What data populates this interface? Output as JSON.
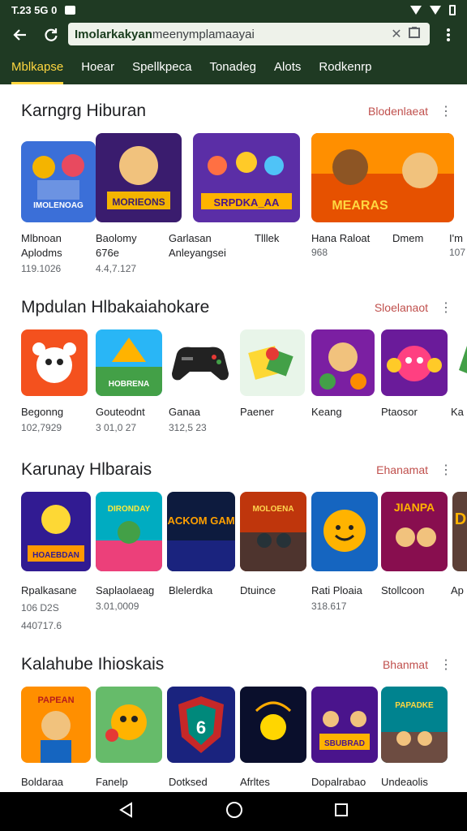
{
  "status_bar": {
    "time": "T.23 5G 0"
  },
  "browser": {
    "back_icon": "arrow-left-icon",
    "refresh_icon": "refresh-icon",
    "url_bold": "Imolarkakyan",
    "url_rest": "meenymplamaayai",
    "clear_icon": "close-icon",
    "tabs_icon": "square-icon",
    "menu_icon": "kebab-icon"
  },
  "tabs": [
    "Mblkapse",
    "Hoear",
    "Spellkpeca",
    "Tonadeg",
    "Alots",
    "Rodkenrp"
  ],
  "sections": [
    {
      "title": "Karngrg Hiburan",
      "more": "Blodenlaeat",
      "apps": [
        {
          "name": "Mlbnoan",
          "line2": "Aplodms",
          "line3": "119.1026",
          "tile_text": "IMOLENOAG"
        },
        {
          "name": "Baolomy",
          "line2": "676e",
          "line3": "4.4,7.127",
          "tile_text": "MORIEONS"
        },
        {
          "name": "Garlasan",
          "line2": "Anleyangsei",
          "line3": "",
          "tile_text": "SRPDKA_AA"
        },
        {
          "name": "Tlllek",
          "line2": "",
          "line3": "",
          "tile_text": ""
        },
        {
          "name": "Hana Raloat",
          "line2": "968",
          "line3": "",
          "tile_text": "MEARAS"
        },
        {
          "name": "Dmem",
          "line2": "",
          "line3": "",
          "tile_text": ""
        },
        {
          "name": "I'm",
          "line2": "107",
          "line3": "",
          "tile_text": ""
        }
      ]
    },
    {
      "title": "Mpdulan Hlbakaiahokare",
      "more": "Sloelanaot",
      "apps": [
        {
          "name": "Begonng",
          "line2": "102,7929",
          "tile_text": ""
        },
        {
          "name": "Gouteodnt",
          "line2": "3 01,0 27",
          "tile_text": "HOBRENA"
        },
        {
          "name": "Ganaa",
          "line2": "312,5 23",
          "tile_text": ""
        },
        {
          "name": "Paener",
          "line2": "",
          "tile_text": ""
        },
        {
          "name": "Keang",
          "line2": "",
          "tile_text": ""
        },
        {
          "name": "Ptaosor",
          "line2": "",
          "tile_text": ""
        },
        {
          "name": "Ka",
          "line2": "",
          "tile_text": ""
        }
      ]
    },
    {
      "title": "Karunay Hlbarais",
      "more": "Ehanamat",
      "apps": [
        {
          "name": "Rpalkasane",
          "line2": "106 D2S",
          "line3": "440717.6",
          "tile_text": "HOAEBDAN"
        },
        {
          "name": "Saplaolaeag",
          "line2": "3.01,0009",
          "line3": "",
          "tile_text": "DIRONDAY"
        },
        {
          "name": "Blelerdka",
          "line2": "",
          "line3": "",
          "tile_text": "SACKOM GAME"
        },
        {
          "name": "Dtuince",
          "line2": "",
          "line3": "",
          "tile_text": "MOLOENA"
        },
        {
          "name": "Rati Ploaia",
          "line2": "318.617",
          "line3": "",
          "tile_text": ""
        },
        {
          "name": "Stollcoon",
          "line2": "",
          "line3": "",
          "tile_text": "JIANPA"
        },
        {
          "name": "Ap",
          "line2": "",
          "line3": "",
          "tile_text": "D"
        }
      ]
    },
    {
      "title": "Kalahube Ihioskais",
      "more": "Bhanmat",
      "apps": [
        {
          "name": "Boldaraa",
          "tile_text": "PAPEAN"
        },
        {
          "name": "Fanelp",
          "tile_text": ""
        },
        {
          "name": "Dotksed",
          "tile_text": "6"
        },
        {
          "name": "Afrltes",
          "tile_text": ""
        },
        {
          "name": "Dopalrabao",
          "tile_text": "SBUBRAD"
        },
        {
          "name": "Undeaolis",
          "tile_text": "PAPADKE"
        }
      ]
    }
  ],
  "nav": {
    "back": "triangle-back-icon",
    "home": "circle-home-icon",
    "recents": "square-recents-icon"
  },
  "colors": {
    "header": "#1f3a23",
    "tab_active": "#ffd740",
    "more_link": "#c0504d"
  }
}
